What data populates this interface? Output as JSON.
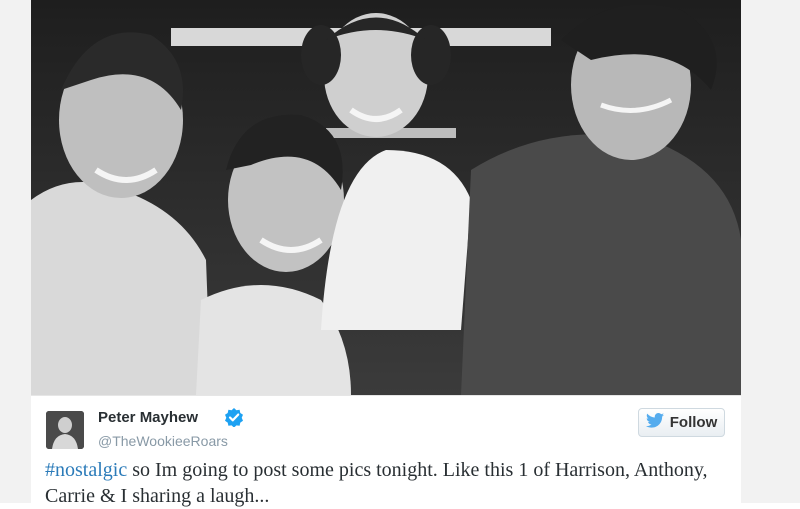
{
  "tweet": {
    "user": {
      "display_name": "Peter Mayhew",
      "handle": "@TheWookieeRoars",
      "verified": true,
      "avatar_icon": "profile-photo"
    },
    "follow_button": {
      "label": "Follow",
      "icon": "twitter-bird-icon"
    },
    "text": {
      "hashtag": "#nostalgic",
      "body": " so Im going to post some pics tonight. Like this 1 of Harrison, Anthony, Carrie & I sharing a laugh..."
    }
  },
  "colors": {
    "hashtag": "#2b7bb9",
    "verified": "#1da1f2",
    "follow_bird": "#55acee",
    "name": "#292f33",
    "handle": "#8899a6"
  }
}
